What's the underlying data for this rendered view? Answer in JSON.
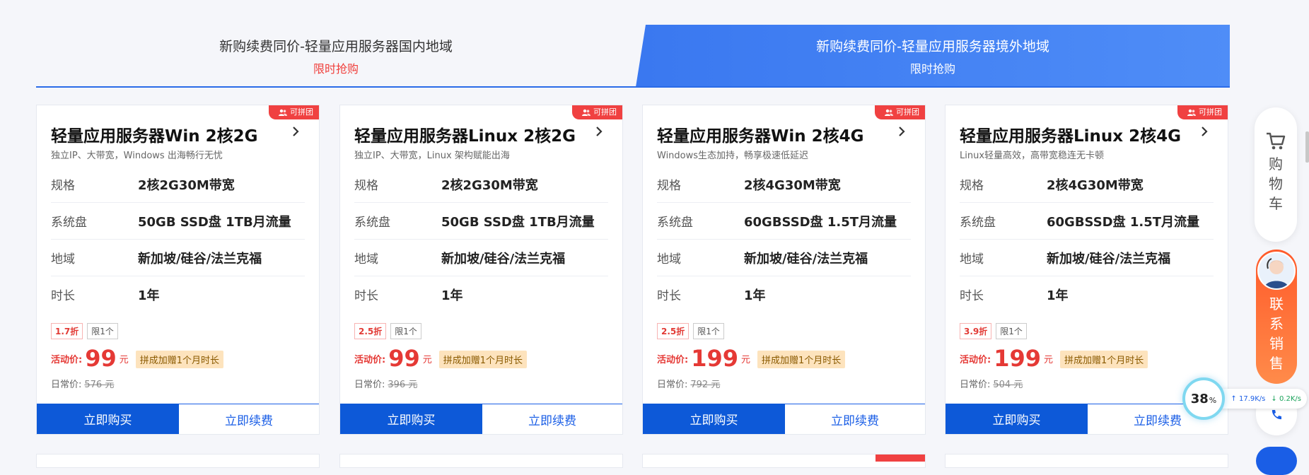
{
  "tabs": [
    {
      "title": "新购续费同价-轻量应用服务器国内地域",
      "subtitle": "限时抢购"
    },
    {
      "title": "新购续费同价-轻量应用服务器境外地域",
      "subtitle": "限时抢购"
    }
  ],
  "labels": {
    "badge": "可拼团",
    "spec": "规格",
    "disk": "系统盘",
    "region": "地域",
    "duration": "时长",
    "limit": "限1个",
    "price_label": "活动价:",
    "currency": "元",
    "gift": "拼成加赠1个月时长",
    "daily_label": "日常价:",
    "buy": "立即购买",
    "renew": "立即续费"
  },
  "cards": [
    {
      "title": "轻量应用服务器Win 2核2G",
      "subtitle": "独立IP、大带宽，Windows 出海畅行无忧",
      "spec": "2核2G30M带宽",
      "disk": "50GB SSD盘 1TB月流量",
      "region": "新加坡/硅谷/法兰克福",
      "duration": "1年",
      "discount": "1.7折",
      "price": "99",
      "daily_price": "576 元"
    },
    {
      "title": "轻量应用服务器Linux 2核2G",
      "subtitle": "独立IP、大带宽，Linux 架构赋能出海",
      "spec": "2核2G30M带宽",
      "disk": "50GB SSD盘 1TB月流量",
      "region": "新加坡/硅谷/法兰克福",
      "duration": "1年",
      "discount": "2.5折",
      "price": "99",
      "daily_price": "396 元"
    },
    {
      "title": "轻量应用服务器Win 2核4G",
      "subtitle": "Windows生态加持，畅享极速低延迟",
      "spec": "2核4G30M带宽",
      "disk": "60GBSSD盘 1.5T月流量",
      "region": "新加坡/硅谷/法兰克福",
      "duration": "1年",
      "discount": "2.5折",
      "price": "199",
      "daily_price": "792 元"
    },
    {
      "title": "轻量应用服务器Linux 2核4G",
      "subtitle": "Linux轻量高效，高带宽稳连无卡顿",
      "spec": "2核4G30M带宽",
      "disk": "60GBSSD盘 1.5T月流量",
      "region": "新加坡/硅谷/法兰克福",
      "duration": "1年",
      "discount": "3.9折",
      "price": "199",
      "daily_price": "504 元"
    }
  ],
  "sidebar": {
    "cart_label": "购物车",
    "sales_label": "联系销售"
  },
  "net": {
    "percent": "38",
    "percent_unit": "%",
    "up": "↑ 17.9K/s",
    "down": "↓ 0.2K/s"
  },
  "colors": {
    "accent": "#0d59d8",
    "price": "#e53935",
    "badge": "#f04141"
  }
}
